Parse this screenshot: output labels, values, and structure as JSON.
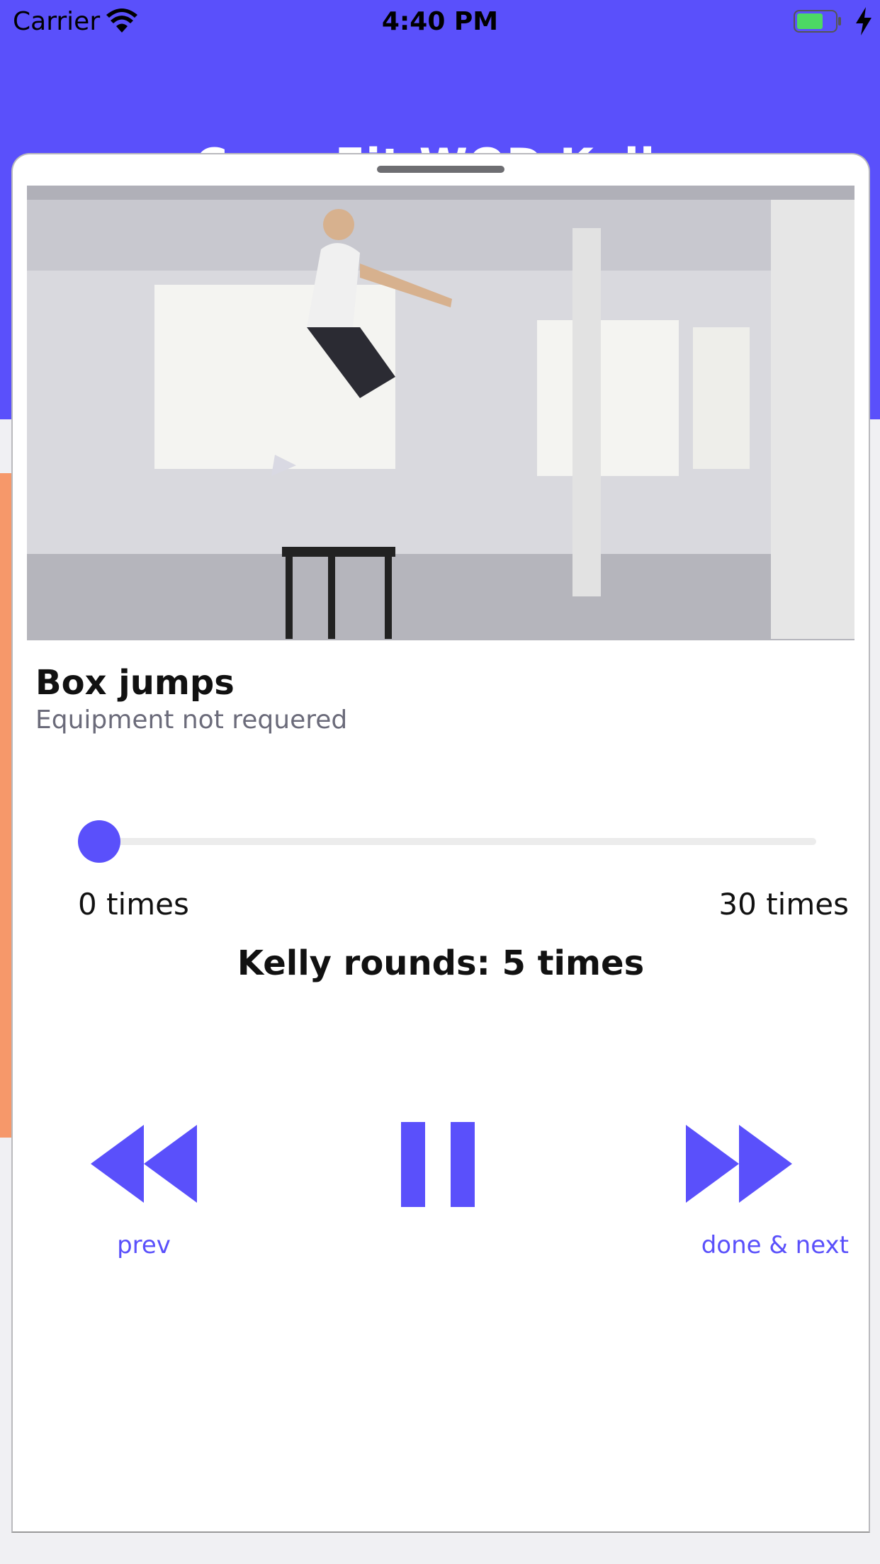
{
  "status_bar": {
    "carrier": "Carrier",
    "time": "4:40 PM"
  },
  "header": {
    "title": "CrossFit WOD Kelly"
  },
  "exercise": {
    "name": "Box jumps",
    "equipment": "Equipment not requered"
  },
  "slider": {
    "value": 0,
    "min_label": "0 times",
    "max_label": "30 times"
  },
  "rounds_label": "Kelly rounds: 5 times",
  "controls": {
    "prev_label": "prev",
    "next_label": "done & next"
  },
  "colors": {
    "accent": "#5a50fb",
    "background_accent": "#f6986a"
  },
  "icons": {
    "wifi": "wifi-icon",
    "battery": "battery-icon",
    "charging": "bolt-icon",
    "prev": "rewind-icon",
    "pause": "pause-icon",
    "next": "fast-forward-icon"
  }
}
